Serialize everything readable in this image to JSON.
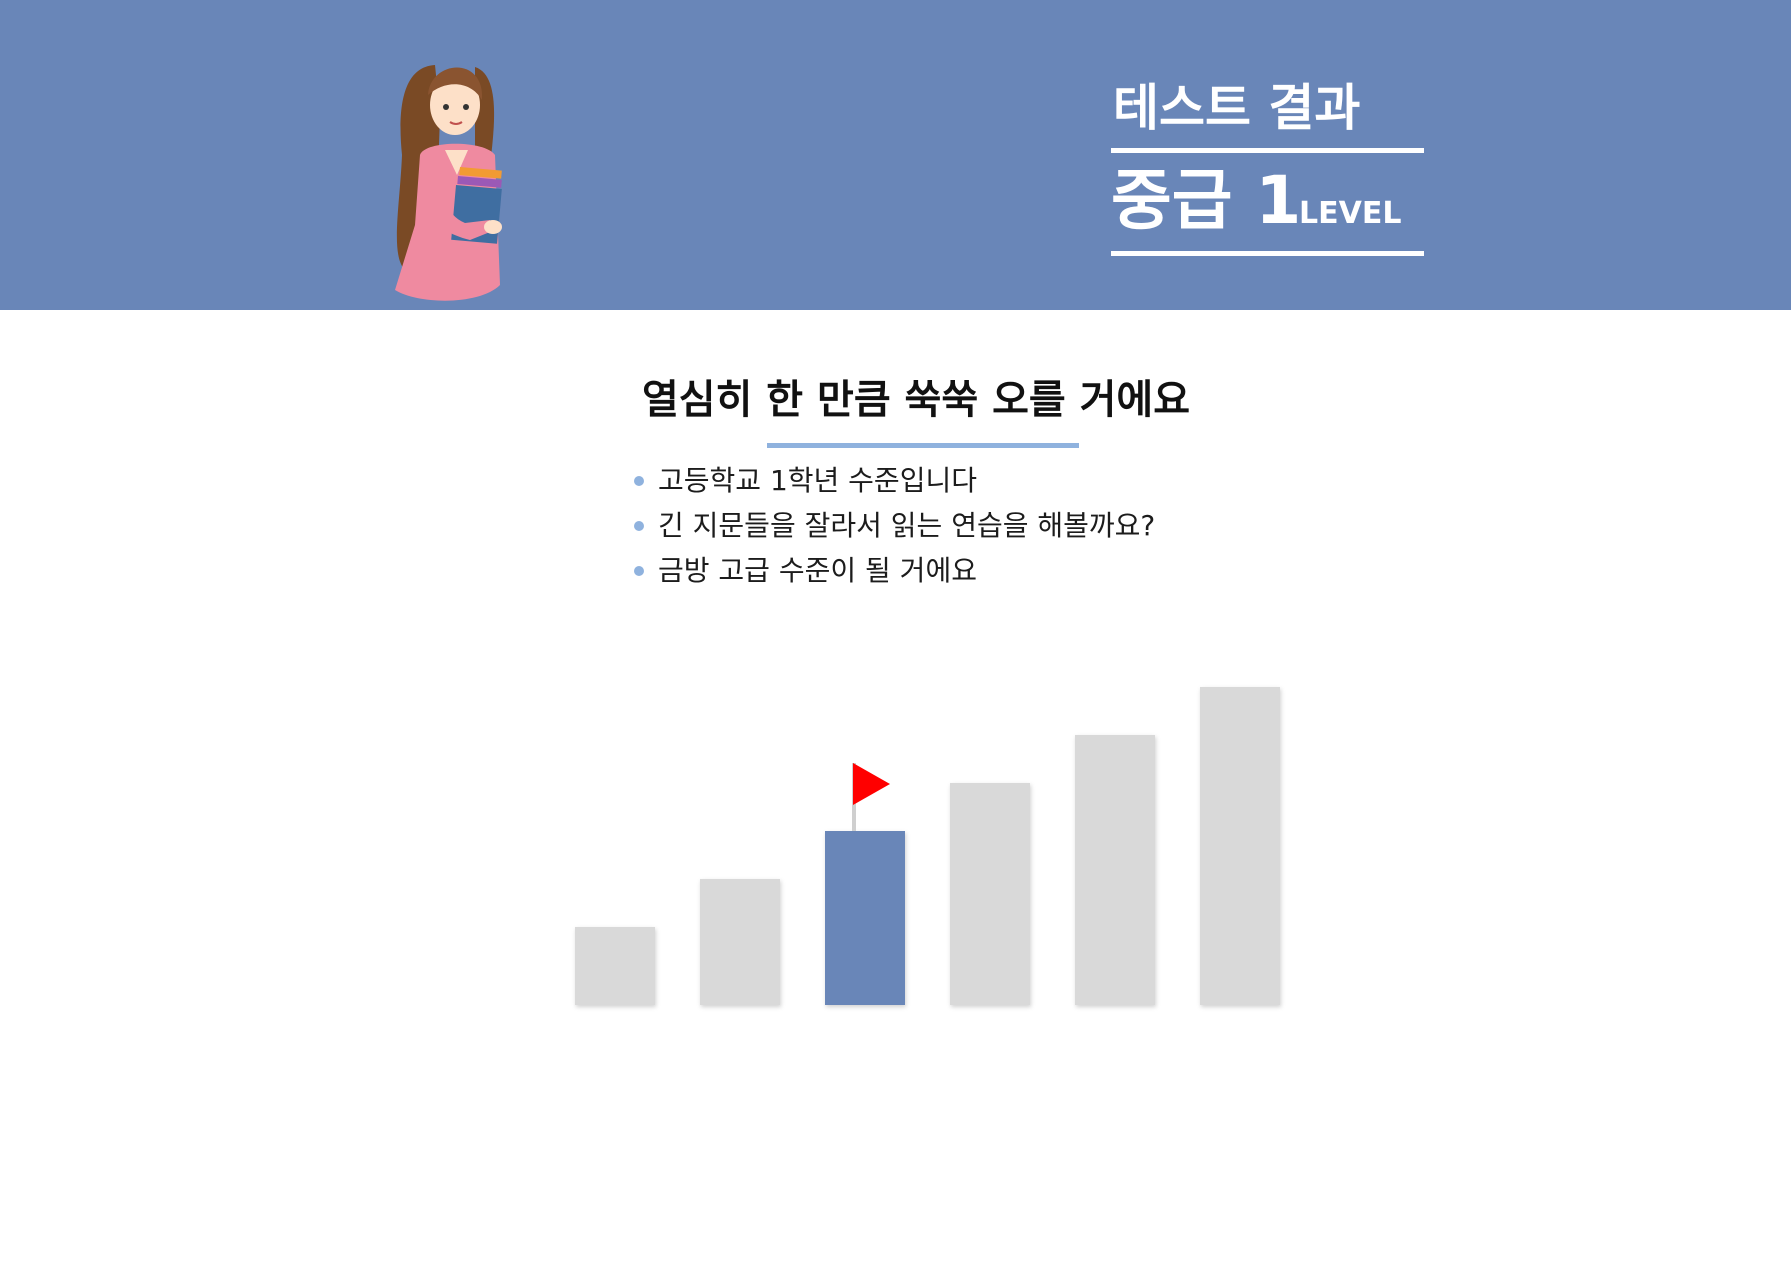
{
  "header": {
    "title": "테스트 결과",
    "level_name": "중급 1",
    "level_word": "LEVEL",
    "background_color": "#6986b8"
  },
  "character": {
    "icon": "student-holding-books-illustration"
  },
  "main": {
    "headline": "열심히 한 만큼 쑥쑥 오를 거에요",
    "bullets": [
      "고등학교 1학년 수준입니다",
      "긴 지문들을 잘라서 읽는 연습을 해볼까요?",
      "금방 고급 수준이 될 거에요"
    ]
  },
  "chart_data": {
    "type": "bar",
    "categories": [
      "",
      "",
      "",
      "",
      "",
      ""
    ],
    "values": [
      1,
      2,
      3,
      4,
      5,
      6
    ],
    "current_index": 2,
    "colors": {
      "current": "#6986b8",
      "other": "#d9d9d9",
      "flag": "#ff0000"
    },
    "flag_icon": "red-flag-icon",
    "grid": false,
    "legend": "none"
  }
}
